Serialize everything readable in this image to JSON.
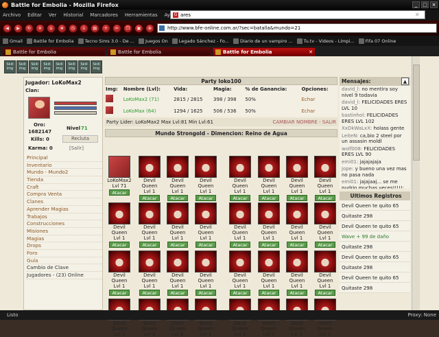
{
  "window": {
    "title": "Battle for Embolia - Mozilla Firefox"
  },
  "menu": [
    "Archivo",
    "Editar",
    "Ver",
    "Historial",
    "Marcadores",
    "Herramientas",
    "Ayuda"
  ],
  "search": {
    "value": "ares"
  },
  "url": "http://www.bfe-online.com.ar/?sec=batalla&mundo=21",
  "bookmarks": [
    "Gmail",
    "Battle for Embolia",
    "Tecno Sims 3.0 - De ...",
    "Juegos On",
    "Legado Sánchez - Fo...",
    "Diario de un vampiro ...",
    "Tu.tv - Videos - Limpi...",
    "Fifa 07 Online"
  ],
  "tabs": [
    "Battle for Embolia",
    "Battle for Embolia",
    "Battle for Embolia"
  ],
  "skills": [
    "Skill img",
    "Skill img",
    "Skill img",
    "Skill img",
    "Skill img",
    "Skill img",
    "Skill img",
    "Skill img"
  ],
  "player": {
    "label": "Jugador: LoKoMax2",
    "clan": "Clan:",
    "oro_label": "Oro:",
    "oro": "1682147",
    "nivel_label": "Nivel",
    "nivel": "71",
    "kills": "Kills: 0",
    "recluta": "Recluta",
    "karma": "Karma: 0",
    "salir": "[Salir]"
  },
  "leftmenu": [
    "Principal",
    "Inventario",
    "Mundo - Mundo2",
    "Tienda",
    "Craft",
    "Compra Venta",
    "Clanes",
    "Aprender Magias",
    "Trabajos",
    "Construcciones",
    "Misiones",
    "Magias",
    "Drops",
    "Foro",
    "Guía",
    "Cambio de Clave",
    "Jugadores - (23) Online"
  ],
  "party": {
    "title": "Party loko100",
    "headers": [
      "Img:",
      "Nombre (Lvl):",
      "Vida:",
      "Magia:",
      "% de Ganancia:",
      "Opciones:"
    ],
    "rows": [
      [
        "LoKoMax2 (71)",
        "2815 / 2815",
        "398 / 398",
        "50%",
        "Echar"
      ],
      [
        "LoKoMax (64)",
        "1294 / 1625",
        "506 / 536",
        "50%",
        "Echar"
      ]
    ],
    "lider": "Party Lider: LoKoMax2 Max Lvl:81 Min Lvl:61",
    "cambiar": "CAMBIAR NOMBRE - SALIR"
  },
  "world": {
    "title": "Mundo Strongold - Dimencion: Reino de Agua",
    "hero_name": "LoKoMax2",
    "hero_level": "Lvl 71",
    "monster_lvl": "Lvl 1",
    "attack": "Atacar",
    "dq_full": "Devil Queen",
    "dq_word1": "Devil",
    "dq_word2": "Queen"
  },
  "messages": {
    "title": "Mensajes:",
    "items": [
      [
        "david_l:",
        "no mentira soy nivel 9 todavia"
      ],
      [
        "david_l:",
        "FELICIDADES ERES LVL 10"
      ],
      [
        "bastinhol:",
        "FELICIDADES ERES LVL 102"
      ],
      [
        "XxDkWaLxX:",
        "holass gente"
      ],
      [
        "LeiteN:",
        "ca,bio 2 steel por un assasin moldl"
      ],
      [
        "wolf008:",
        "FELICIDADES ERES LVL 90"
      ],
      [
        "emi01:",
        "jajajajaja"
      ],
      [
        "jope:",
        "y bueno una vez mas no pasa nada"
      ],
      [
        "emi01:",
        "jajajaaj... se me pudrio muchas veces!!!!!;"
      ],
      [
        "jope:",
        "porque sino se te va a podrir el rancho"
      ]
    ]
  },
  "registros": {
    "title": "Ultimos Registros",
    "items": [
      "Devil Queen te quito 65",
      "Quitaste 298",
      "Devil Queen te quito 65",
      "Wave + 99 de daño",
      "Quitaste 298",
      "Devil Queen te quito 65",
      "Quitaste 298",
      "Devil Queen te quito 65",
      "Quitaste 298"
    ]
  },
  "status": {
    "left": "Listo",
    "right": "Proxy: None"
  }
}
